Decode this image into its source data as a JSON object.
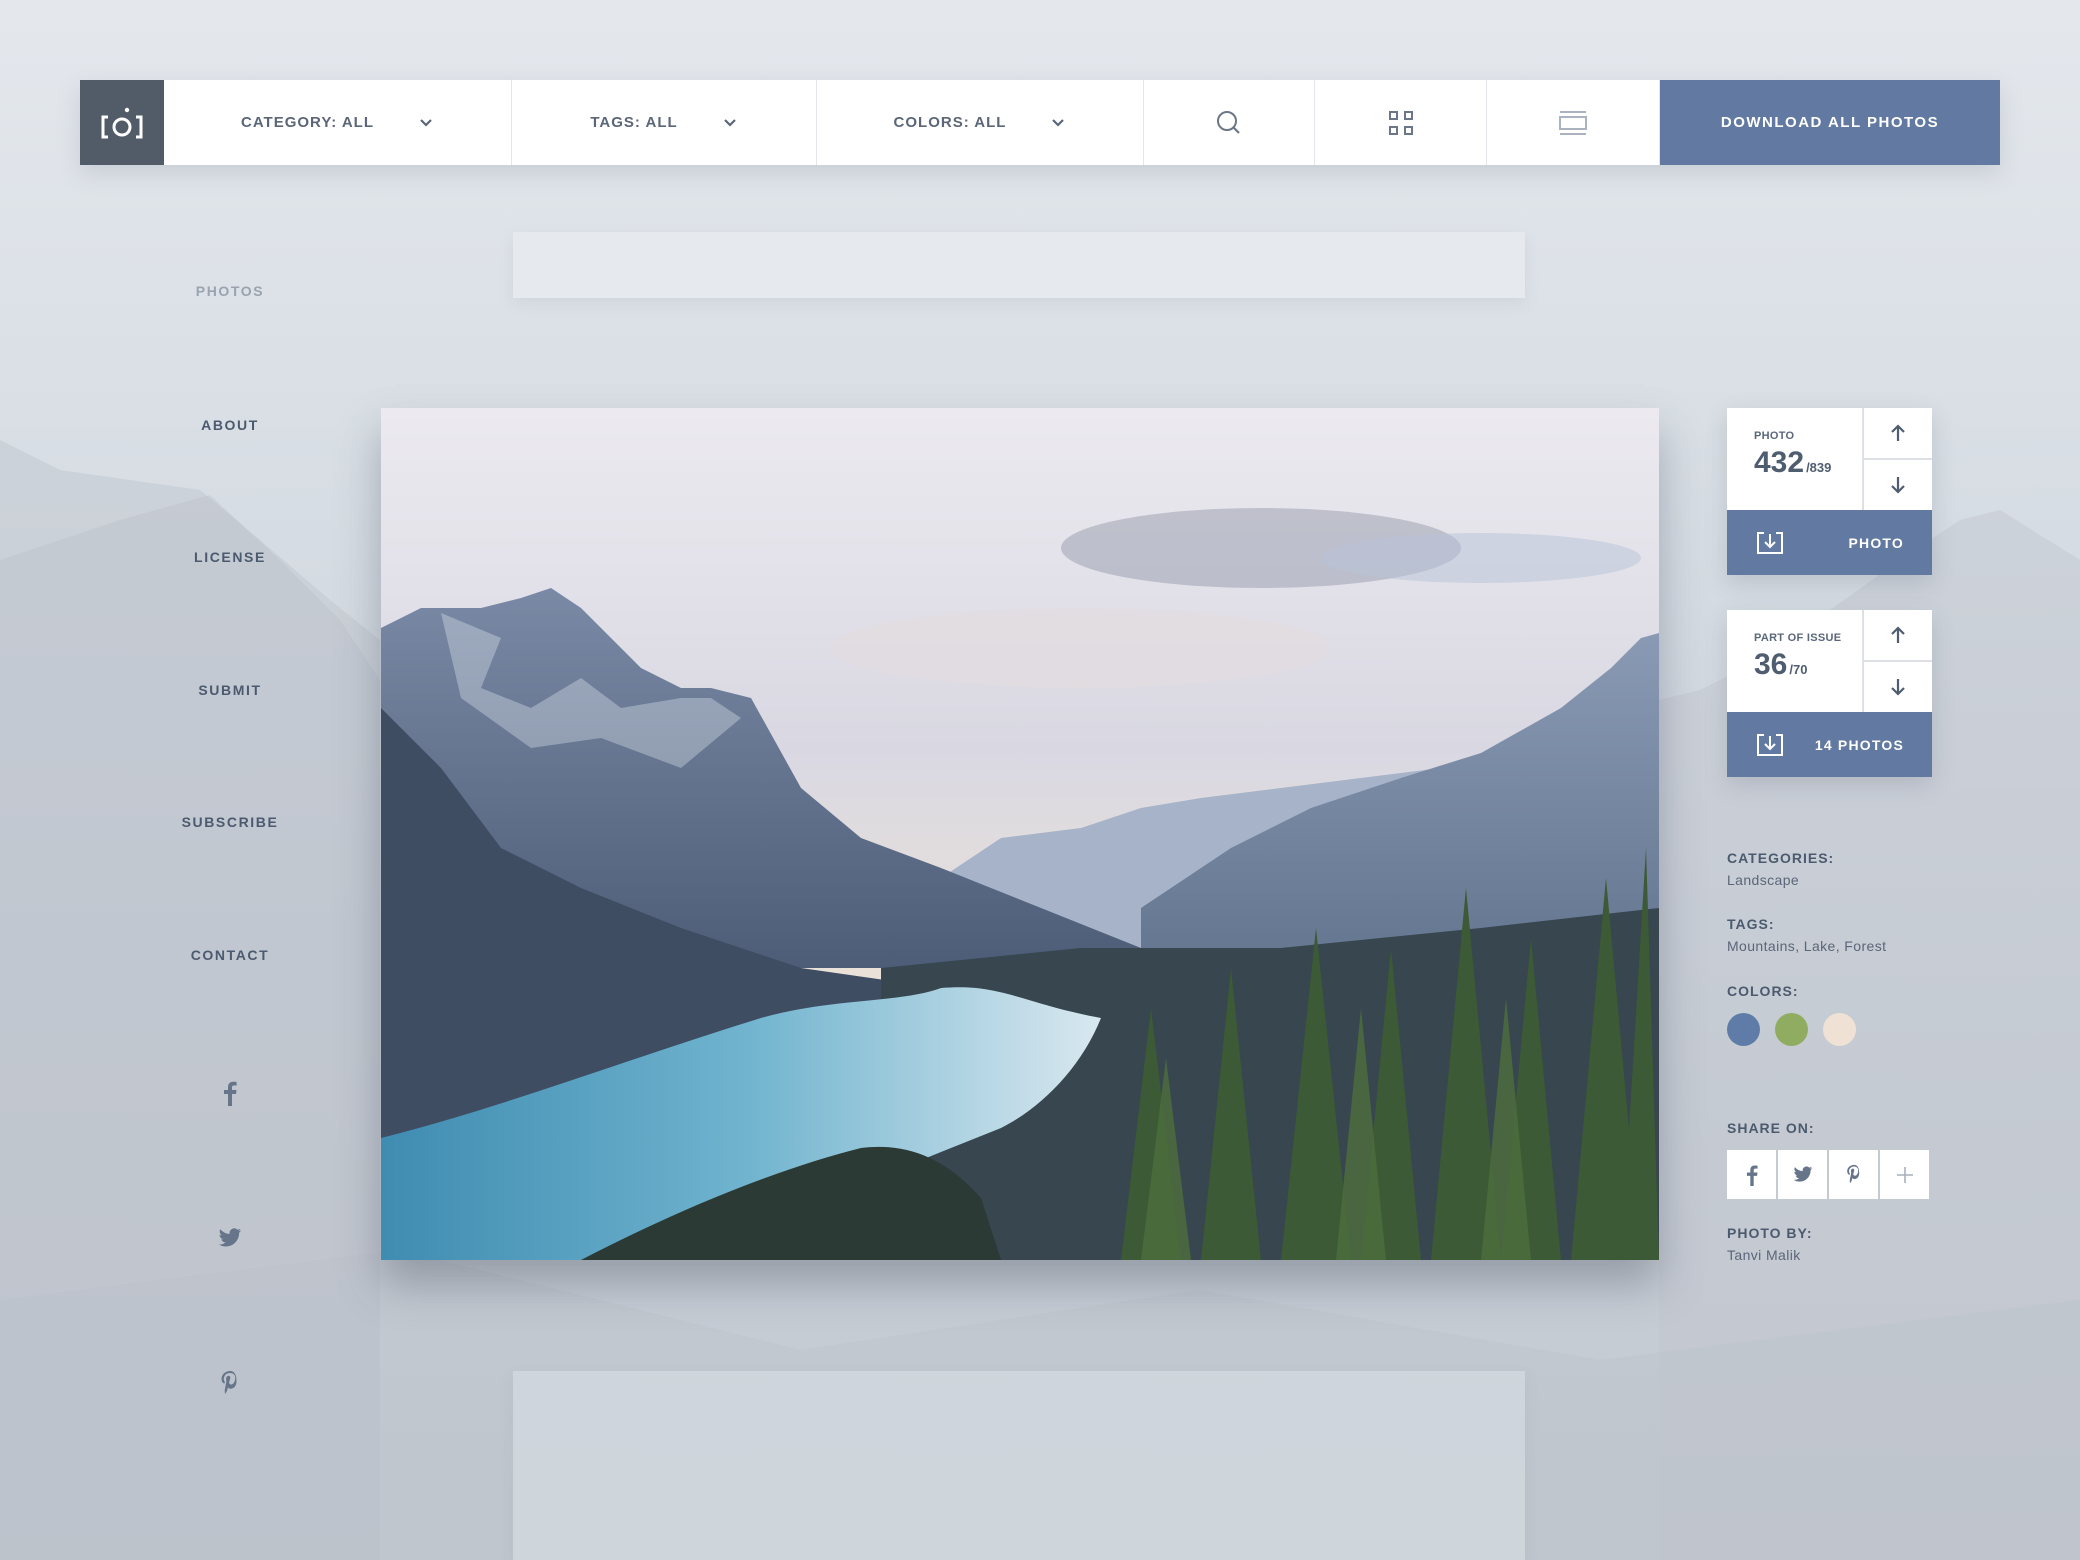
{
  "topbar": {
    "logo": "[o]",
    "filters": [
      {
        "label": "CATEGORY: ALL"
      },
      {
        "label": "TAGS: ALL"
      },
      {
        "label": "COLORS: ALL"
      }
    ],
    "icons": [
      "search-icon",
      "grid-view-icon",
      "list-view-icon"
    ],
    "download_all_label": "DOWNLOAD ALL PHOTOS"
  },
  "nav": {
    "items": [
      {
        "label": "PHOTOS",
        "active": false
      },
      {
        "label": "ABOUT"
      },
      {
        "label": "LICENSE"
      },
      {
        "label": "SUBMIT"
      },
      {
        "label": "SUBSCRIBE"
      },
      {
        "label": "CONTACT"
      }
    ],
    "social": [
      "facebook-icon",
      "twitter-icon",
      "pinterest-icon"
    ]
  },
  "photo_card": {
    "label": "PHOTO",
    "current": "432",
    "total": "/839",
    "download_label": "PHOTO"
  },
  "issue_card": {
    "label": "PART OF ISSUE",
    "current": "36",
    "total": "/70",
    "download_label": "14 PHOTOS"
  },
  "details": {
    "categories_label": "CATEGORIES:",
    "categories_value": "Landscape",
    "tags_label": "TAGS:",
    "tags_value": "Mountains, Lake, Forest",
    "colors_label": "COLORS:",
    "colors": [
      "#5f7ca8",
      "#8fac60",
      "#efe2d4"
    ],
    "share_label": "SHARE ON:",
    "share": [
      "facebook-icon",
      "twitter-icon",
      "pinterest-icon",
      "plus-icon"
    ],
    "photo_by_label": "PHOTO BY:",
    "photo_by_value": "Tanvi Malik"
  },
  "theme": {
    "accent": "#627aa1",
    "logo_bg": "#525c68",
    "text": "#4f5d70"
  }
}
